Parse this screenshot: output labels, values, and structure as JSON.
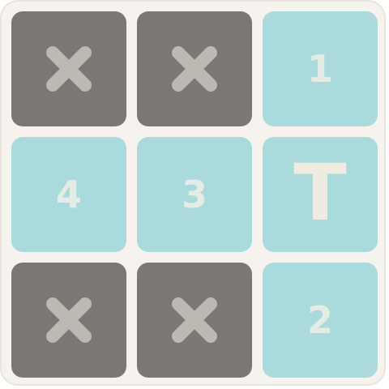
{
  "board": {
    "background_color": "#f6f3ee",
    "blocked_color": "#7b7775",
    "open_color": "#aadadb",
    "tiles": [
      {
        "row": 1,
        "col": 1,
        "state": "blocked",
        "icon": "x-icon"
      },
      {
        "row": 1,
        "col": 2,
        "state": "blocked",
        "icon": "x-icon"
      },
      {
        "row": 1,
        "col": 3,
        "state": "number",
        "label": "1"
      },
      {
        "row": 2,
        "col": 1,
        "state": "number",
        "label": "4"
      },
      {
        "row": 2,
        "col": 2,
        "state": "number",
        "label": "3"
      },
      {
        "row": 2,
        "col": 3,
        "state": "letter",
        "label": "T"
      },
      {
        "row": 3,
        "col": 1,
        "state": "blocked",
        "icon": "x-icon"
      },
      {
        "row": 3,
        "col": 2,
        "state": "blocked",
        "icon": "x-icon"
      },
      {
        "row": 3,
        "col": 3,
        "state": "number",
        "label": "2"
      }
    ]
  }
}
